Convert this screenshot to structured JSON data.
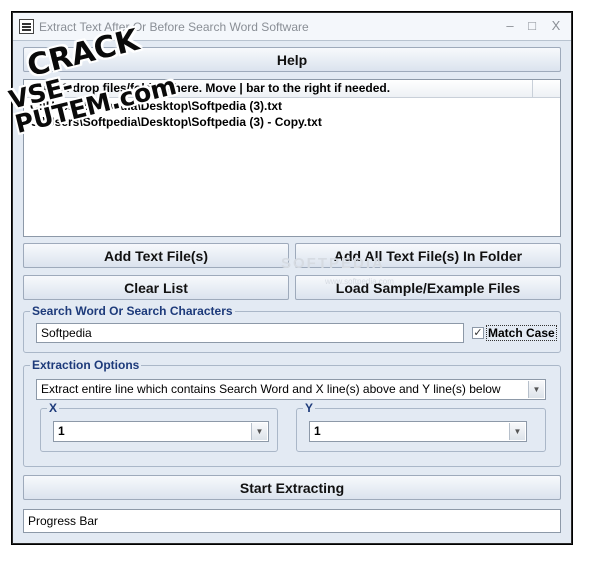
{
  "window": {
    "title": "Extract Text After Or Before Search Word Software",
    "minimize_glyph": "–",
    "maximize_glyph": "□",
    "close_glyph": "X"
  },
  "help_button": "Help",
  "file_list": {
    "header": "Drag & drop files/folders here. Move | bar to the right if needed.",
    "items": [
      "C:\\Users\\Softpedia\\Desktop\\Softpedia (3).txt",
      "C:\\Users\\Softpedia\\Desktop\\Softpedia (3) - Copy.txt"
    ]
  },
  "buttons": {
    "add_files": "Add Text File(s)",
    "add_folder": "Add All Text File(s) In Folder",
    "clear_list": "Clear List",
    "load_sample": "Load Sample/Example Files",
    "start": "Start Extracting"
  },
  "search": {
    "group_label": "Search Word Or Search Characters",
    "value": "Softpedia",
    "match_case_label": "Match Case",
    "match_case_checked": true,
    "check_glyph": "✓"
  },
  "extraction": {
    "group_label": "Extraction Options",
    "selected_option": "Extract entire line which contains Search Word and X line(s) above and Y line(s) below",
    "x_label": "X",
    "x_value": "1",
    "y_label": "Y",
    "y_value": "1",
    "dropdown_glyph": "▼"
  },
  "progress_bar": "Progress Bar",
  "watermark": {
    "line1": "CRACK",
    "line2": "VSE-PUTEM.com",
    "faint_text": "SOFTPEDIA",
    "faint_sub": "www.softpedia.com"
  },
  "colors": {
    "window_bg": "#e3eaf3",
    "group_label": "#1d3a7a",
    "title_text": "#8a8f96"
  }
}
